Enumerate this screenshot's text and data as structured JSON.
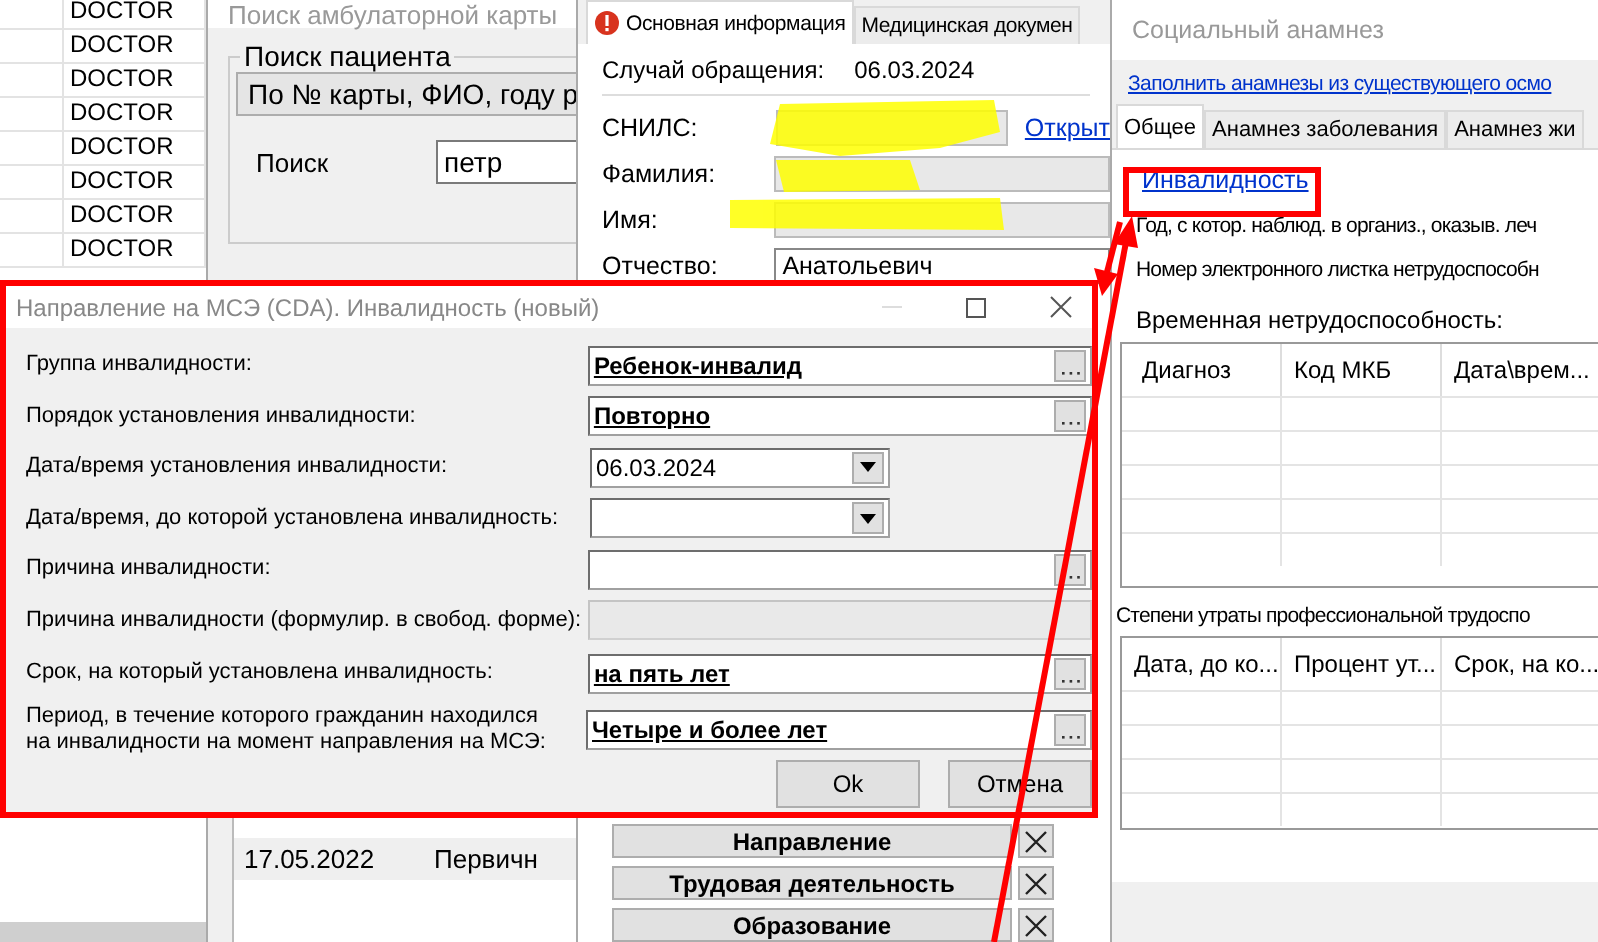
{
  "doctor_list": {
    "rows": [
      "DOCTOR",
      "DOCTOR",
      "DOCTOR",
      "DOCTOR",
      "DOCTOR",
      "DOCTOR",
      "DOCTOR",
      "DOCTOR"
    ]
  },
  "search_window": {
    "title": "Поиск амбулаторной карты",
    "group_title": "Поиск пациента",
    "search_mode": "По № карты, ФИО, году р",
    "search_label": "Поиск",
    "search_value": "петр",
    "visits": [
      {
        "date": "17.05.2022",
        "type": "Первичн",
        "selected": true
      }
    ]
  },
  "patient_window": {
    "tabs": [
      {
        "label": "Основная информация",
        "selected": true,
        "warning": true
      },
      {
        "label": "Медицинская докумен",
        "selected": false,
        "warning": false
      }
    ],
    "case_label": "Случай обращения:",
    "case_date": "06.03.2024",
    "open_link": "Открыт",
    "fields": [
      {
        "label": "СНИЛС:",
        "redacted": true
      },
      {
        "label": "Фамилия:",
        "redacted": true
      },
      {
        "label": "Имя:",
        "redacted": true
      },
      {
        "label": "Отчество:",
        "value": "Анатольевич",
        "redacted": false
      }
    ],
    "sections": [
      "Направление",
      "Трудовая деятельность",
      "Образование"
    ]
  },
  "social_window": {
    "title": "Социальный анамнез",
    "fill_link": "Заполнить анамнезы из существующего осмо",
    "tabs": [
      {
        "label": "Общее",
        "selected": true
      },
      {
        "label": "Анамнез заболевания",
        "selected": false
      },
      {
        "label": "Анамнез жи",
        "selected": false
      }
    ],
    "disability_link": "Инвалидность",
    "lines": [
      "Год, с котор. наблюд. в организ., оказыв. леч",
      "Номер электронного листка нетрудоспособн"
    ],
    "temp_label": "Временная нетрудоспособность:",
    "temp_columns": [
      "Диагноз",
      "Код МКБ",
      "Дата\\врем..."
    ],
    "loss_label": "Степени утраты профессиональной трудоспо",
    "loss_columns": [
      "Дата, до ко...",
      "Процент ут...",
      "Срок, на ко..."
    ]
  },
  "dialog": {
    "title": "Направление на МСЭ (CDA). Инвалидность (новый)",
    "fields": [
      {
        "label": "Группа инвалидности:",
        "value": "Ребенок-инвалид",
        "kind": "lookup",
        "disabled": false
      },
      {
        "label": "Порядок установления инвалидности:",
        "value": "Повторно",
        "kind": "lookup",
        "disabled": false
      },
      {
        "label": "Дата/время установления инвалидности:",
        "value": "06.03.2024",
        "kind": "date",
        "disabled": false
      },
      {
        "label": "Дата/время, до которой установлена инвалидность:",
        "kind": "date",
        "disabled": false
      },
      {
        "label": "Причина инвалидности:",
        "kind": "lookup",
        "disabled": false
      },
      {
        "label": "Причина инвалидности (формулир. в свобод. форме):",
        "kind": "text",
        "disabled": true
      },
      {
        "label": "Срок, на который установлена инвалидность:",
        "value": "на пять лет",
        "kind": "lookup",
        "disabled": false
      },
      {
        "label": "Период, в течение которого гражданин находился на инвалидности на момент направления на МСЭ:",
        "value": "Четыре и более лет",
        "kind": "lookup",
        "disabled": false
      }
    ],
    "buttons": [
      "Ok",
      "Отмена"
    ]
  }
}
